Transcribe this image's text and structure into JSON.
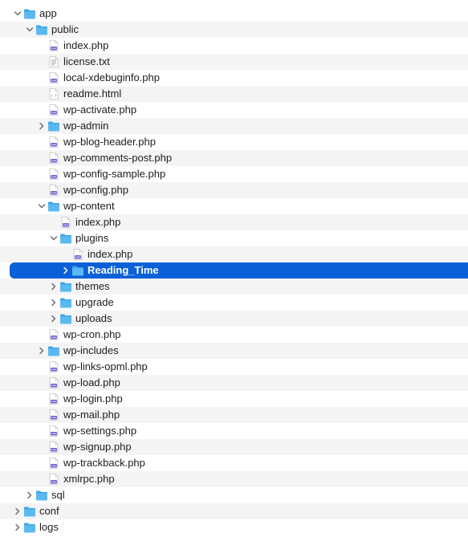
{
  "tree": [
    {
      "label": "app",
      "type": "folder",
      "depth": 0,
      "expanded": true
    },
    {
      "label": "public",
      "type": "folder",
      "depth": 1,
      "expanded": true
    },
    {
      "label": "index.php",
      "type": "php",
      "depth": 2
    },
    {
      "label": "license.txt",
      "type": "txt",
      "depth": 2
    },
    {
      "label": "local-xdebuginfo.php",
      "type": "php",
      "depth": 2
    },
    {
      "label": "readme.html",
      "type": "html",
      "depth": 2
    },
    {
      "label": "wp-activate.php",
      "type": "php",
      "depth": 2
    },
    {
      "label": "wp-admin",
      "type": "folder",
      "depth": 2,
      "expanded": false
    },
    {
      "label": "wp-blog-header.php",
      "type": "php",
      "depth": 2
    },
    {
      "label": "wp-comments-post.php",
      "type": "php",
      "depth": 2
    },
    {
      "label": "wp-config-sample.php",
      "type": "php",
      "depth": 2
    },
    {
      "label": "wp-config.php",
      "type": "php",
      "depth": 2
    },
    {
      "label": "wp-content",
      "type": "folder",
      "depth": 2,
      "expanded": true
    },
    {
      "label": "index.php",
      "type": "php",
      "depth": 3
    },
    {
      "label": "plugins",
      "type": "folder",
      "depth": 3,
      "expanded": true
    },
    {
      "label": "index.php",
      "type": "php",
      "depth": 4
    },
    {
      "label": "Reading_Time",
      "type": "folder",
      "depth": 4,
      "expanded": false,
      "selected": true
    },
    {
      "label": "themes",
      "type": "folder",
      "depth": 3,
      "expanded": false
    },
    {
      "label": "upgrade",
      "type": "folder",
      "depth": 3,
      "expanded": false
    },
    {
      "label": "uploads",
      "type": "folder",
      "depth": 3,
      "expanded": false
    },
    {
      "label": "wp-cron.php",
      "type": "php",
      "depth": 2
    },
    {
      "label": "wp-includes",
      "type": "folder",
      "depth": 2,
      "expanded": false
    },
    {
      "label": "wp-links-opml.php",
      "type": "php",
      "depth": 2
    },
    {
      "label": "wp-load.php",
      "type": "php",
      "depth": 2
    },
    {
      "label": "wp-login.php",
      "type": "php",
      "depth": 2
    },
    {
      "label": "wp-mail.php",
      "type": "php",
      "depth": 2
    },
    {
      "label": "wp-settings.php",
      "type": "php",
      "depth": 2
    },
    {
      "label": "wp-signup.php",
      "type": "php",
      "depth": 2
    },
    {
      "label": "wp-trackback.php",
      "type": "php",
      "depth": 2
    },
    {
      "label": "xmlrpc.php",
      "type": "php",
      "depth": 2
    },
    {
      "label": "sql",
      "type": "folder",
      "depth": 1,
      "expanded": false
    },
    {
      "label": "conf",
      "type": "folder",
      "depth": 0,
      "expanded": false
    },
    {
      "label": "logs",
      "type": "folder",
      "depth": 0,
      "expanded": false
    }
  ],
  "icons": {
    "folder": "folder-icon",
    "php": "php-file-icon",
    "txt": "text-file-icon",
    "html": "html-file-icon",
    "expanded": "chevron-down-icon",
    "collapsed": "chevron-right-icon"
  },
  "colors": {
    "selection": "#0a60d8",
    "folder": "#5cb8f0",
    "folder_tab": "#3da7e8",
    "php_badge": "#7a5fd1",
    "stripe": "#f4f4f5"
  }
}
